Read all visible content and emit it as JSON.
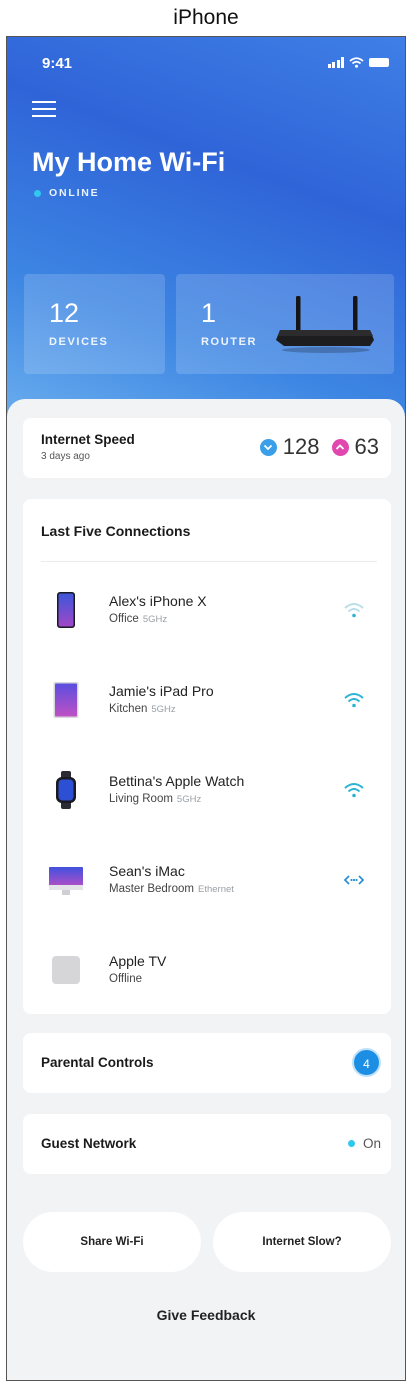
{
  "device_caption": "iPhone",
  "status_bar": {
    "time": "9:41"
  },
  "header": {
    "title": "My Home Wi-Fi",
    "status": "ONLINE"
  },
  "tiles": {
    "devices": {
      "count": "12",
      "label": "DEVICES"
    },
    "routers": {
      "count": "1",
      "label": "ROUTER"
    }
  },
  "internet_speed": {
    "title": "Internet Speed",
    "subtitle": "3 days ago",
    "download": "128",
    "upload": "63"
  },
  "connections": {
    "title": "Last Five Connections",
    "items": [
      {
        "name": "Alex's iPhone X",
        "location": "Office",
        "band": "5GHz",
        "icon": "phone-icon",
        "connection": "wifi-weak-icon"
      },
      {
        "name": "Jamie's iPad Pro",
        "location": "Kitchen",
        "band": "5GHz",
        "icon": "tablet-icon",
        "connection": "wifi-icon"
      },
      {
        "name": "Bettina's Apple Watch",
        "location": "Living Room",
        "band": "5GHz",
        "icon": "watch-icon",
        "connection": "wifi-icon"
      },
      {
        "name": "Sean's iMac",
        "location": "Master Bedroom",
        "band": "Ethernet",
        "icon": "desktop-icon",
        "connection": "ethernet-icon"
      },
      {
        "name": "Apple TV",
        "location": "Offline",
        "band": "",
        "icon": "tv-box-icon",
        "connection": ""
      }
    ]
  },
  "parental_controls": {
    "title": "Parental Controls",
    "count": "4"
  },
  "guest_network": {
    "title": "Guest Network",
    "status": "On"
  },
  "actions": {
    "share_wifi": "Share Wi-Fi",
    "internet_slow": "Internet Slow?",
    "feedback": "Give Feedback"
  },
  "colors": {
    "hero": "#3572de",
    "accent": "#1c8fe4",
    "online": "#30c8ee",
    "download": "#3a9fe8",
    "upload": "#e048b0"
  }
}
